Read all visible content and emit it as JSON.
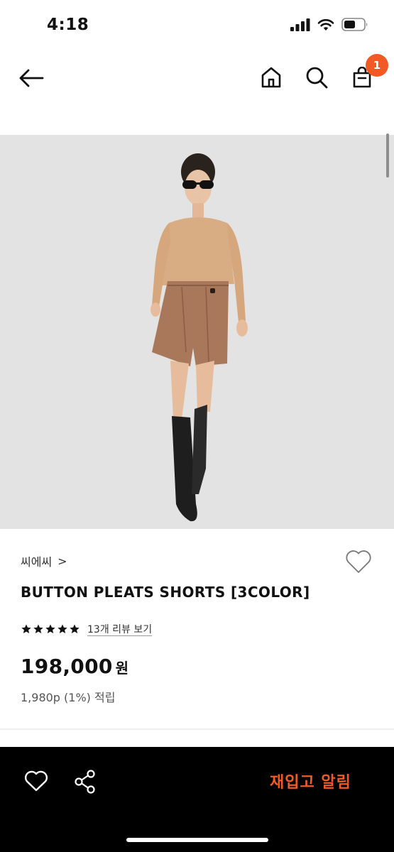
{
  "status_bar": {
    "time": "4:18",
    "icons": [
      "signal-icon",
      "wifi-icon",
      "battery-icon"
    ]
  },
  "nav": {
    "icons": [
      "back-arrow-icon",
      "home-icon",
      "search-icon",
      "cart-icon"
    ],
    "cart_count": "1"
  },
  "product": {
    "brand": "씨에씨",
    "brand_chevron": ">",
    "name": "BUTTON PLEATS SHORTS [3COLOR]",
    "rating": 5,
    "review_link": "13개 리뷰 보기",
    "price": "198,000",
    "price_unit": "원",
    "points": "1,980p (1%) 적립"
  },
  "bottom_bar": {
    "restock_label": "재입고 알림",
    "icons": [
      "heart-icon",
      "share-icon"
    ]
  },
  "colors": {
    "accent": "#f15a24",
    "hero_bg": "#e3e3e3",
    "bottom_bar_bg": "#000000"
  }
}
